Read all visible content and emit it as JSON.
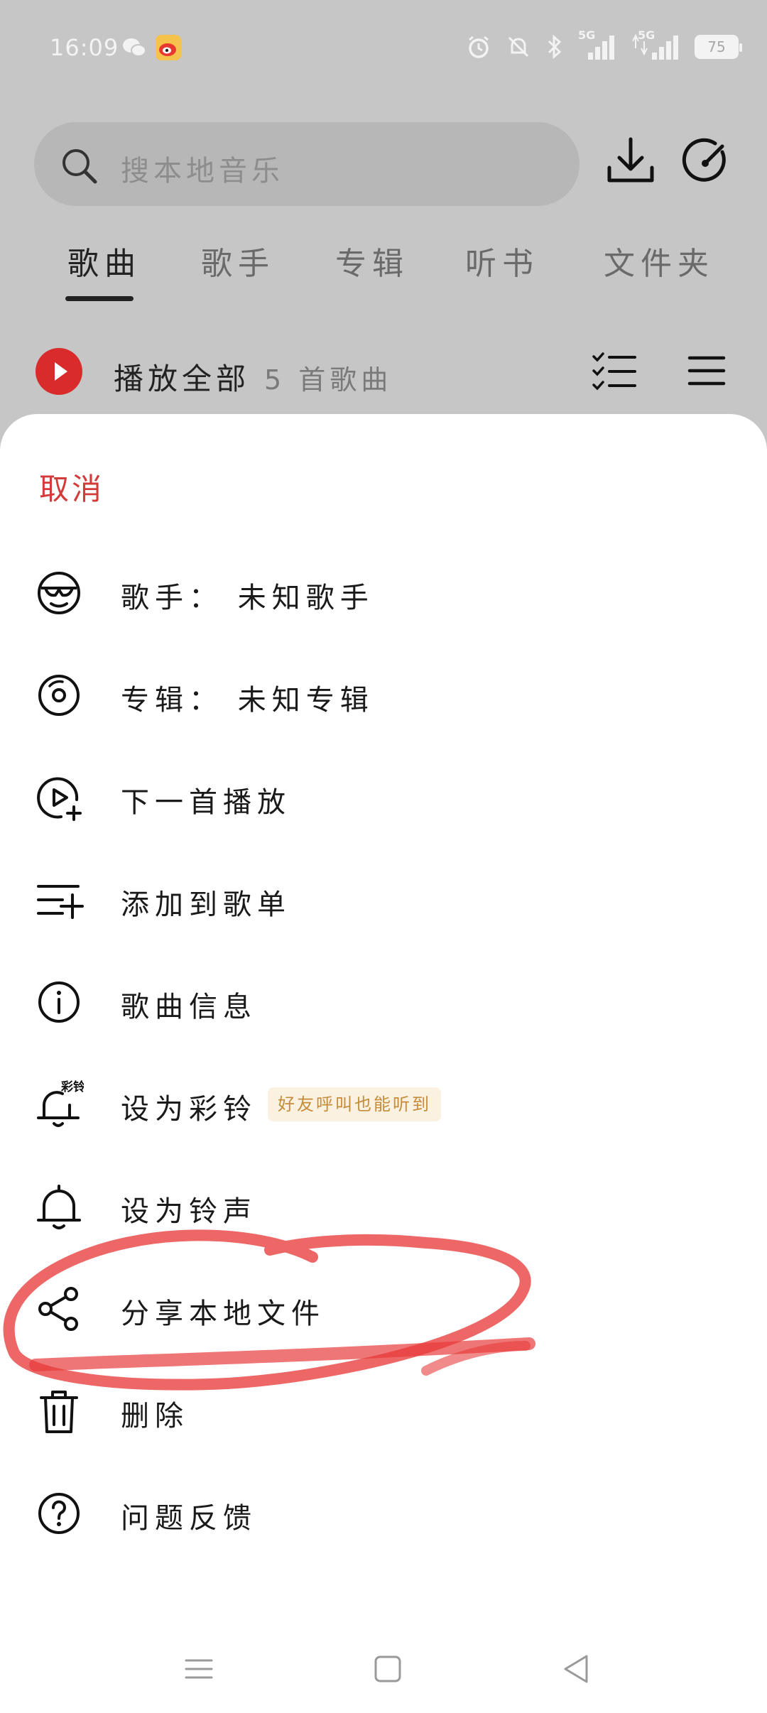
{
  "status_bar": {
    "time": "16:09",
    "battery": "75",
    "network_1": "5G",
    "network_2": "5G"
  },
  "search": {
    "placeholder": "搜本地音乐"
  },
  "tabs": [
    {
      "label": "歌曲",
      "active": true
    },
    {
      "label": "歌手",
      "active": false
    },
    {
      "label": "专辑",
      "active": false
    },
    {
      "label": "听书",
      "active": false
    },
    {
      "label": "文件夹",
      "active": false
    }
  ],
  "play_all": {
    "label": "播放全部",
    "count": "5 首歌曲"
  },
  "sheet": {
    "cancel": "取消",
    "items": [
      {
        "label": "歌手： 未知歌手",
        "icon": "singer-icon"
      },
      {
        "label": "专辑： 未知专辑",
        "icon": "album-disc-icon"
      },
      {
        "label": "下一首播放",
        "icon": "play-next-icon"
      },
      {
        "label": "添加到歌单",
        "icon": "add-to-playlist-icon"
      },
      {
        "label": "歌曲信息",
        "icon": "info-icon"
      },
      {
        "label": "设为彩铃",
        "icon": "color-ringtone-bell-icon",
        "tag": "好友呼叫也能听到",
        "icon_text": "彩铃"
      },
      {
        "label": "设为铃声",
        "icon": "bell-icon"
      },
      {
        "label": "分享本地文件",
        "icon": "share-icon"
      },
      {
        "label": "删除",
        "icon": "trash-icon"
      },
      {
        "label": "问题反馈",
        "icon": "feedback-question-icon"
      }
    ]
  },
  "colors": {
    "accent_red": "#d33a3a",
    "play_red": "#d92b2b",
    "annotation_red": "#e83c3c",
    "tag_bg": "#fbf1e1",
    "tag_text": "#c58c3a"
  }
}
